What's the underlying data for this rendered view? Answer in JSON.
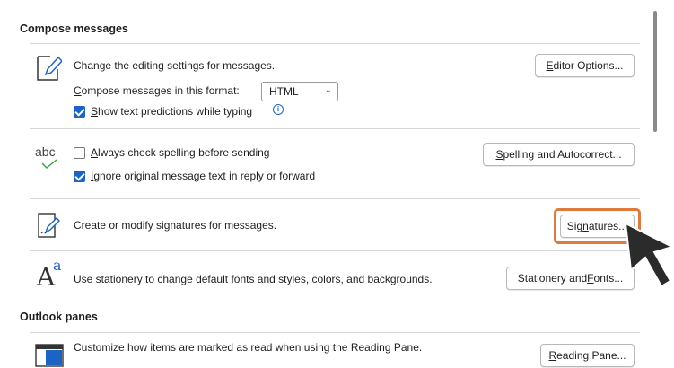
{
  "sections": {
    "compose_title": "Compose messages",
    "outlook_panes_title": "Outlook panes"
  },
  "editing": {
    "text": "Change the editing settings for messages.",
    "button": "Editor Options...",
    "button_underline_char": "E",
    "format_label_u": "C",
    "format_label_rest": "ompose messages in this format:",
    "format_value": "HTML",
    "predictions_u": "S",
    "predictions_rest": "how text predictions while typing"
  },
  "spelling": {
    "abc": "abc",
    "always_u": "A",
    "always_rest": "lways check spelling before sending",
    "ignore_u": "I",
    "ignore_rest": "gnore original message text in reply or forward",
    "button_pre": "",
    "button_u": "S",
    "button_rest": "pelling and Autocorrect..."
  },
  "signatures": {
    "text": "Create or modify signatures for messages.",
    "button_pre": "Sig",
    "button_u": "n",
    "button_rest": "atures..."
  },
  "stationery": {
    "text": "Use stationery to change default fonts and styles, colors, and backgrounds.",
    "button_pre": "Stationery and ",
    "button_u": "F",
    "button_rest": "onts..."
  },
  "reading": {
    "text": "Customize how items are marked as read when using the Reading Pane.",
    "button_pre": "",
    "button_u": "R",
    "button_rest": "eading Pane..."
  },
  "state": {
    "show_predictions_checked": true,
    "always_check_spelling_checked": false,
    "ignore_original_checked": true
  },
  "colors": {
    "highlight": "#e07a3c",
    "checkbox_blue": "#1a64c8"
  },
  "icons": [
    "edit-pen-icon",
    "spell-check-icon",
    "signature-icon",
    "stationery-icon",
    "reading-pane-icon",
    "pointer-cursor-icon"
  ]
}
